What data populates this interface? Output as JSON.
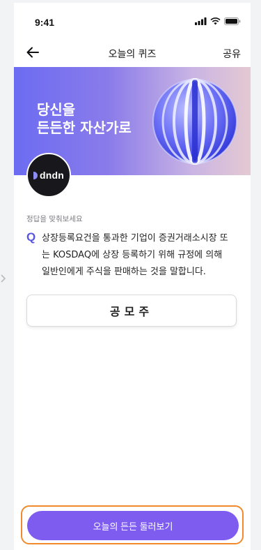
{
  "status_bar": {
    "time": "9:41",
    "icons": [
      "signal-icon",
      "wifi-icon",
      "battery-icon"
    ]
  },
  "nav": {
    "back_icon": "arrow-left-icon",
    "title": "오늘의 퀴즈",
    "share_label": "공유"
  },
  "banner": {
    "line1": "당신을",
    "line2": "든든한 자산가로",
    "colors": {
      "start": "#6c6cf2",
      "end": "#e4c9d2",
      "ball": "#4a4ef0"
    }
  },
  "logo": {
    "text": "dndn"
  },
  "quiz": {
    "instruction": "정답을 맞춰보세요",
    "marker": "Q",
    "question_lines": [
      "상장등록요건을 통과한 기업이 증권거래소시장 또",
      "는 KOSDAQ에 상장 등록하기 위해 규정에 의해",
      "일반인에게 주식을 판매하는 것을 말합니다."
    ],
    "answer": "공모주"
  },
  "cta": {
    "label": "오늘의 든든 둘러보기",
    "color": "#7f5cf0",
    "outline_color": "#f08a2c"
  }
}
